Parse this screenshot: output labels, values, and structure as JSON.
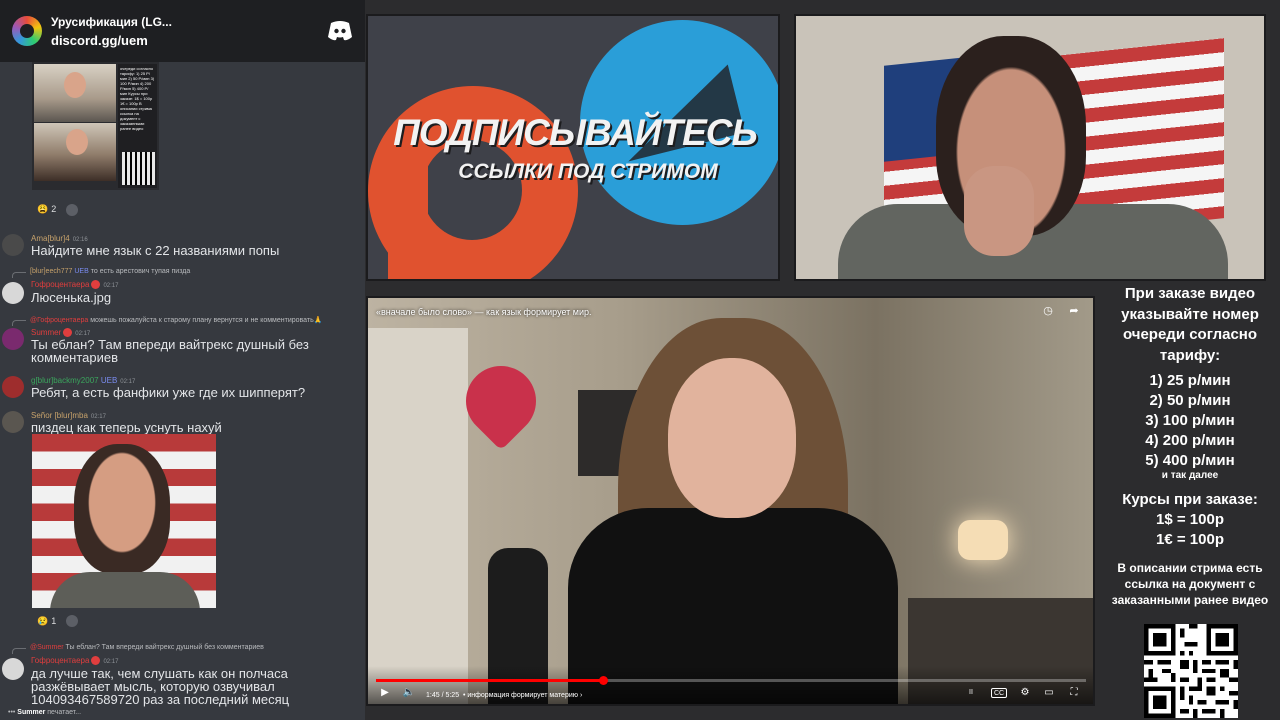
{
  "chat": {
    "server_name": "Урусификация (LG...",
    "invite": "discord.gg/uem",
    "thumb_tariff_text": "очереди согласно тарифу: 1) 25 Р/мин 2) 50 Р/мин 3) 100 Р/мин 4) 200 Р/мин 5) 400 Р/мин Курсы при заказе: 1$ = 100р 1€ = 100р В описании стрима ссылка на документ с заказанными ранее видео",
    "reaction_1_count": "2",
    "messages": [
      {
        "user": "Ama[blur]4",
        "time": "02:16",
        "text": "Найдите мне язык с 22 названиями попы",
        "user_color": "#c7a26b"
      },
      {
        "reply_user": "[blur]eech777",
        "reply_badge": "UEB",
        "reply_text": "то есть арестович тупая пизда",
        "user": "Гофроцентаера",
        "time": "02:17",
        "text": "Люсенька.jpg",
        "user_color": "#e03e3e"
      },
      {
        "reply_user": "@Гофроцентаера",
        "reply_text": "можешь пожалуйста к старому плану вернутся и не комментировать🙏",
        "user": "Summer",
        "time": "02:17",
        "text": "Ты еблан? Там впереди вайтрекс душный без комментариев",
        "user_color": "#e03e3e"
      },
      {
        "user": "g[blur]backmy2007",
        "badge": "UEB",
        "time": "02:17",
        "text": "Ребят, а есть фанфики уже где их шипперят?",
        "user_color": "#3ba55d"
      },
      {
        "user": "Señor [blur]mba",
        "time": "02:17",
        "text": "пиздец как теперь уснуть нахуй",
        "user_color": "#c7a26b"
      },
      {
        "reply_user": "@Summer",
        "reply_text": "Ты еблан? Там впереди вайтрекс душный без комментариев",
        "user": "Гофроцентаера",
        "time": "02:17",
        "text": "да лучше так, чем слушать как он полчаса разжёвывает мысль, которую озвучивал 104093467589720 раз за последний месяц",
        "user_color": "#e03e3e"
      }
    ],
    "reaction_2_count": "1",
    "typing_user": "Summer",
    "typing_text": "печатает..."
  },
  "banner": {
    "title": "ПОДПИСЫВАЙТЕСЬ",
    "subtitle": "ССЫЛКИ ПОД СТРИМОМ"
  },
  "player": {
    "title": "«вначале было слово» — как язык формирует мир.",
    "time": "1:45 / 5:25",
    "chapter": "• информация формирует материю ›",
    "progress": 0.32,
    "progress_color": "#ff0000"
  },
  "info": {
    "order_text": "При заказе видео указывайте номер очереди согласно тарифу:",
    "tariffs": [
      "1) 25 р/мин",
      "2) 50 р/мин",
      "3) 100 р/мин",
      "4) 200 р/мин",
      "5) 400 р/мин"
    ],
    "tariffs_more": "и так далее",
    "rates_title": "Курсы при заказе:",
    "rate_usd": "1$ = 100р",
    "rate_eur": "1€ = 100р",
    "description": "В описании стрима есть ссылка на документ с заказанными ранее видео"
  },
  "icons": {
    "discord": "discord-logo-icon",
    "clock": "watch-later-icon",
    "share": "share-icon",
    "play": "play-icon",
    "volume": "volume-icon",
    "subtitles": "subtitles-icon",
    "settings": "settings-icon",
    "cast": "cast-icon",
    "fullscreen": "fullscreen-icon"
  }
}
